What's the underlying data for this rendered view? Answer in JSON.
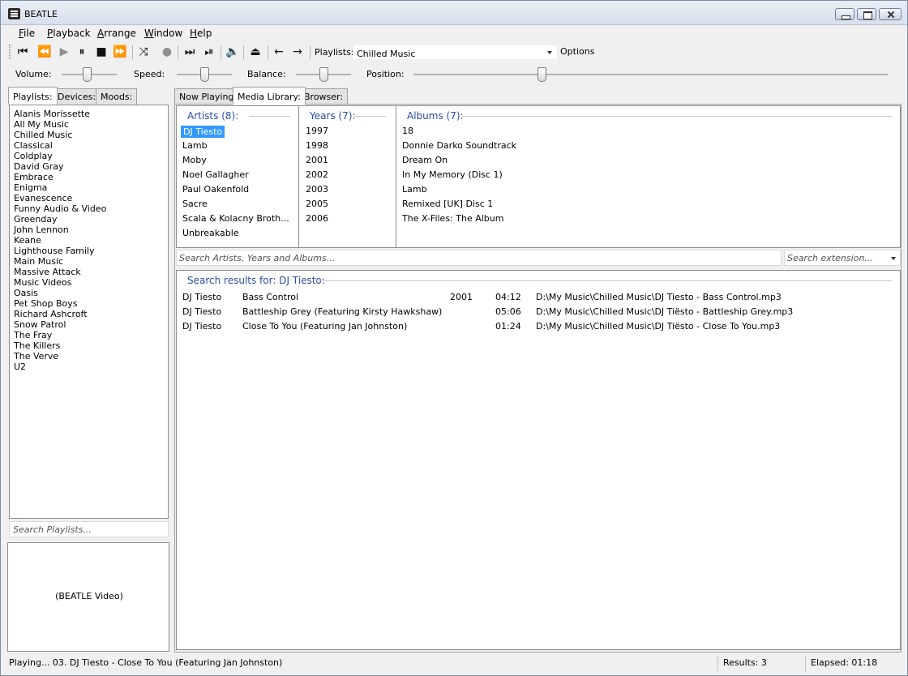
{
  "window": {
    "title": "BEATLE"
  },
  "menu": [
    {
      "key": "F",
      "rest": "ile"
    },
    {
      "key": "P",
      "rest": "layback"
    },
    {
      "key": "A",
      "rest": "rrange"
    },
    {
      "key": "W",
      "rest": "indow"
    },
    {
      "key": "H",
      "rest": "elp"
    }
  ],
  "toolbar": {
    "playlists_label": "Playlists:",
    "playlist_selected": "Chilled Music",
    "options_label": "Options"
  },
  "sliders": {
    "volume_label": "Volume:",
    "speed_label": "Speed:",
    "balance_label": "Balance:",
    "position_label": "Position:",
    "volume_level": 0.45,
    "speed_level": 0.5,
    "balance_level": 0.5,
    "position_level": 0.27
  },
  "left_tabs": [
    "Playlists:",
    "Devices:",
    "Moods:"
  ],
  "playlists": [
    "Alanis Morissette",
    "All My Music",
    "Chilled Music",
    "Classical",
    "Coldplay",
    "David Gray",
    "Embrace",
    "Enigma",
    "Evanescence",
    "Funny Audio & Video",
    "Greenday",
    "John Lennon",
    "Keane",
    "Lighthouse Family",
    "Main Music",
    "Massive Attack",
    "Music Videos",
    "Oasis",
    "Pet Shop Boys",
    "Richard Ashcroft",
    "Snow Patrol",
    "The Fray",
    "The Killers",
    "The Verve",
    "U2"
  ],
  "search_playlists_placeholder": "Search Playlists...",
  "video_label": "(BEATLE Video)",
  "right_tabs": [
    "Now Playing:",
    "Media Library:",
    "Browser:"
  ],
  "library": {
    "artists_header": "Artists (8):",
    "years_header": "Years (7):",
    "albums_header": "Albums (7):",
    "artists": [
      "DJ Tiesto",
      "Lamb",
      "Moby",
      "Noel Gallagher",
      "Paul Oakenfold",
      "Sacre",
      "Scala & Kolacny Broth...",
      "Unbreakable"
    ],
    "years": [
      "1997",
      "1998",
      "2001",
      "2002",
      "2003",
      "2005",
      "2006"
    ],
    "albums": [
      "18",
      "Donnie Darko Soundtrack",
      "Dream On",
      "In My Memory (Disc 1)",
      "Lamb",
      "Remixed [UK] Disc 1",
      "The X-Files: The Album"
    ],
    "search_placeholder": "Search Artists, Years and Albums...",
    "search_extension_placeholder": "Search extension..."
  },
  "results": {
    "header": "Search results for:  DJ Tiesto:",
    "rows": [
      {
        "artist": "DJ Tiesto",
        "title": "Bass Control",
        "year": "2001",
        "time": "04:12",
        "path": "D:\\My Music\\Chilled Music\\DJ Tiesto - Bass Control.mp3"
      },
      {
        "artist": "DJ Tiesto",
        "title": "Battleship Grey (Featuring Kirsty Hawkshaw)",
        "year": "",
        "time": "05:06",
        "path": "D:\\My Music\\Chilled Music\\DJ Tiësto - Battleship Grey.mp3"
      },
      {
        "artist": "DJ Tiesto",
        "title": "Close To You (Featuring Jan Johnston)",
        "year": "",
        "time": "01:24",
        "path": "D:\\My Music\\Chilled Music\\DJ Tiësto - Close To You.mp3"
      }
    ]
  },
  "status": {
    "playing": "Playing... 03.  DJ Tiesto - Close To You (Featuring Jan Johnston)",
    "results": "Results:  3",
    "elapsed": "Elapsed:  01:18"
  },
  "colors": {
    "accent_header": "#2a4ea0",
    "selection": "#3399ff"
  }
}
